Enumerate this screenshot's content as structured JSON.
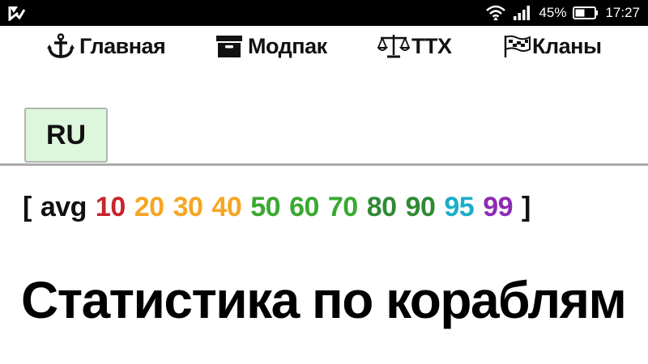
{
  "status_bar": {
    "battery_percent": "45%",
    "time": "17:27",
    "icons": [
      "app-notification-icon",
      "wifi-icon",
      "signal-icon",
      "battery-icon"
    ]
  },
  "nav": {
    "items": [
      {
        "label": "Главная",
        "icon": "anchor-icon"
      },
      {
        "label": "Модпак",
        "icon": "box-icon"
      },
      {
        "label": "ТТХ",
        "icon": "scales-icon"
      },
      {
        "label": "Кланы",
        "icon": "flags-icon"
      }
    ]
  },
  "region": {
    "label": "RU"
  },
  "legend": {
    "open": "[",
    "close": "]",
    "avg_label": "avg",
    "levels": [
      {
        "label": "10",
        "color": "#c8232c"
      },
      {
        "label": "20",
        "color": "#f5a623"
      },
      {
        "label": "30",
        "color": "#f5a623"
      },
      {
        "label": "40",
        "color": "#f5a623"
      },
      {
        "label": "50",
        "color": "#3aa832"
      },
      {
        "label": "60",
        "color": "#3aa832"
      },
      {
        "label": "70",
        "color": "#3aa832"
      },
      {
        "label": "80",
        "color": "#2f8a34"
      },
      {
        "label": "90",
        "color": "#2f8a34"
      },
      {
        "label": "95",
        "color": "#1aaec8"
      },
      {
        "label": "99",
        "color": "#8e2bb5"
      }
    ]
  },
  "page": {
    "title": "Статистика по кораблям"
  }
}
